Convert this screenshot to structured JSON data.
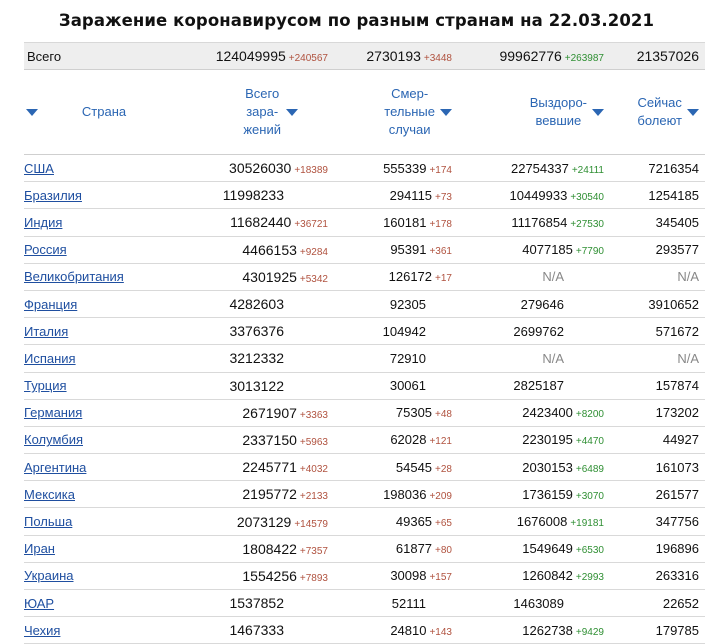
{
  "title": "Заражение коронавирусом по разным странам на 22.03.2021",
  "total": {
    "label": "Всего",
    "infected": "124049995",
    "infected_inc": "+240567",
    "deaths": "2730193",
    "deaths_inc": "+3448",
    "recovered": "99962776",
    "recovered_inc": "+263987",
    "active": "21357026"
  },
  "headers": {
    "country": "Страна",
    "infected": [
      "Всего",
      "зара-",
      "жений"
    ],
    "deaths": [
      "Смер-",
      "тельные",
      "случаи"
    ],
    "recovered": [
      "Выздоро-",
      "вевшие"
    ],
    "active": [
      "Сейчас",
      "болеют"
    ]
  },
  "icons": {
    "sort": "sort-down-triangle-icon"
  },
  "colors": {
    "link": "#1f4fa0",
    "header": "#2b66b3",
    "increase_red": "#b0523f",
    "increase_green": "#2f8f33"
  },
  "rows": [
    {
      "country": "США",
      "infected": "30526030",
      "infected_inc": "+18389",
      "deaths": "555339",
      "deaths_inc": "+174",
      "recovered": "22754337",
      "recovered_inc": "+24111",
      "active": "7216354"
    },
    {
      "country": "Бразилия",
      "infected": "11998233",
      "infected_inc": "",
      "deaths": "294115",
      "deaths_inc": "+73",
      "recovered": "10449933",
      "recovered_inc": "+30540",
      "active": "1254185"
    },
    {
      "country": "Индия",
      "infected": "11682440",
      "infected_inc": "+36721",
      "deaths": "160181",
      "deaths_inc": "+178",
      "recovered": "11176854",
      "recovered_inc": "+27530",
      "active": "345405"
    },
    {
      "country": "Россия",
      "infected": "4466153",
      "infected_inc": "+9284",
      "deaths": "95391",
      "deaths_inc": "+361",
      "recovered": "4077185",
      "recovered_inc": "+7790",
      "active": "293577"
    },
    {
      "country": "Великобритания",
      "infected": "4301925",
      "infected_inc": "+5342",
      "deaths": "126172",
      "deaths_inc": "+17",
      "recovered": "N/A",
      "recovered_inc": "",
      "active": "N/A"
    },
    {
      "country": "Франция",
      "infected": "4282603",
      "infected_inc": "",
      "deaths": "92305",
      "deaths_inc": "",
      "recovered": "279646",
      "recovered_inc": "",
      "active": "3910652"
    },
    {
      "country": "Италия",
      "infected": "3376376",
      "infected_inc": "",
      "deaths": "104942",
      "deaths_inc": "",
      "recovered": "2699762",
      "recovered_inc": "",
      "active": "571672"
    },
    {
      "country": "Испания",
      "infected": "3212332",
      "infected_inc": "",
      "deaths": "72910",
      "deaths_inc": "",
      "recovered": "N/A",
      "recovered_inc": "",
      "active": "N/A"
    },
    {
      "country": "Турция",
      "infected": "3013122",
      "infected_inc": "",
      "deaths": "30061",
      "deaths_inc": "",
      "recovered": "2825187",
      "recovered_inc": "",
      "active": "157874"
    },
    {
      "country": "Германия",
      "infected": "2671907",
      "infected_inc": "+3363",
      "deaths": "75305",
      "deaths_inc": "+48",
      "recovered": "2423400",
      "recovered_inc": "+8200",
      "active": "173202"
    },
    {
      "country": "Колумбия",
      "infected": "2337150",
      "infected_inc": "+5963",
      "deaths": "62028",
      "deaths_inc": "+121",
      "recovered": "2230195",
      "recovered_inc": "+4470",
      "active": "44927"
    },
    {
      "country": "Аргентина",
      "infected": "2245771",
      "infected_inc": "+4032",
      "deaths": "54545",
      "deaths_inc": "+28",
      "recovered": "2030153",
      "recovered_inc": "+6489",
      "active": "161073"
    },
    {
      "country": "Мексика",
      "infected": "2195772",
      "infected_inc": "+2133",
      "deaths": "198036",
      "deaths_inc": "+209",
      "recovered": "1736159",
      "recovered_inc": "+3070",
      "active": "261577"
    },
    {
      "country": "Польша",
      "infected": "2073129",
      "infected_inc": "+14579",
      "deaths": "49365",
      "deaths_inc": "+65",
      "recovered": "1676008",
      "recovered_inc": "+19181",
      "active": "347756"
    },
    {
      "country": "Иран",
      "infected": "1808422",
      "infected_inc": "+7357",
      "deaths": "61877",
      "deaths_inc": "+80",
      "recovered": "1549649",
      "recovered_inc": "+6530",
      "active": "196896"
    },
    {
      "country": "Украина",
      "infected": "1554256",
      "infected_inc": "+7893",
      "deaths": "30098",
      "deaths_inc": "+157",
      "recovered": "1260842",
      "recovered_inc": "+2993",
      "active": "263316"
    },
    {
      "country": "ЮАР",
      "infected": "1537852",
      "infected_inc": "",
      "deaths": "52111",
      "deaths_inc": "",
      "recovered": "1463089",
      "recovered_inc": "",
      "active": "22652"
    },
    {
      "country": "Чехия",
      "infected": "1467333",
      "infected_inc": "",
      "deaths": "24810",
      "deaths_inc": "+143",
      "recovered": "1262738",
      "recovered_inc": "+9429",
      "active": "179785"
    }
  ]
}
